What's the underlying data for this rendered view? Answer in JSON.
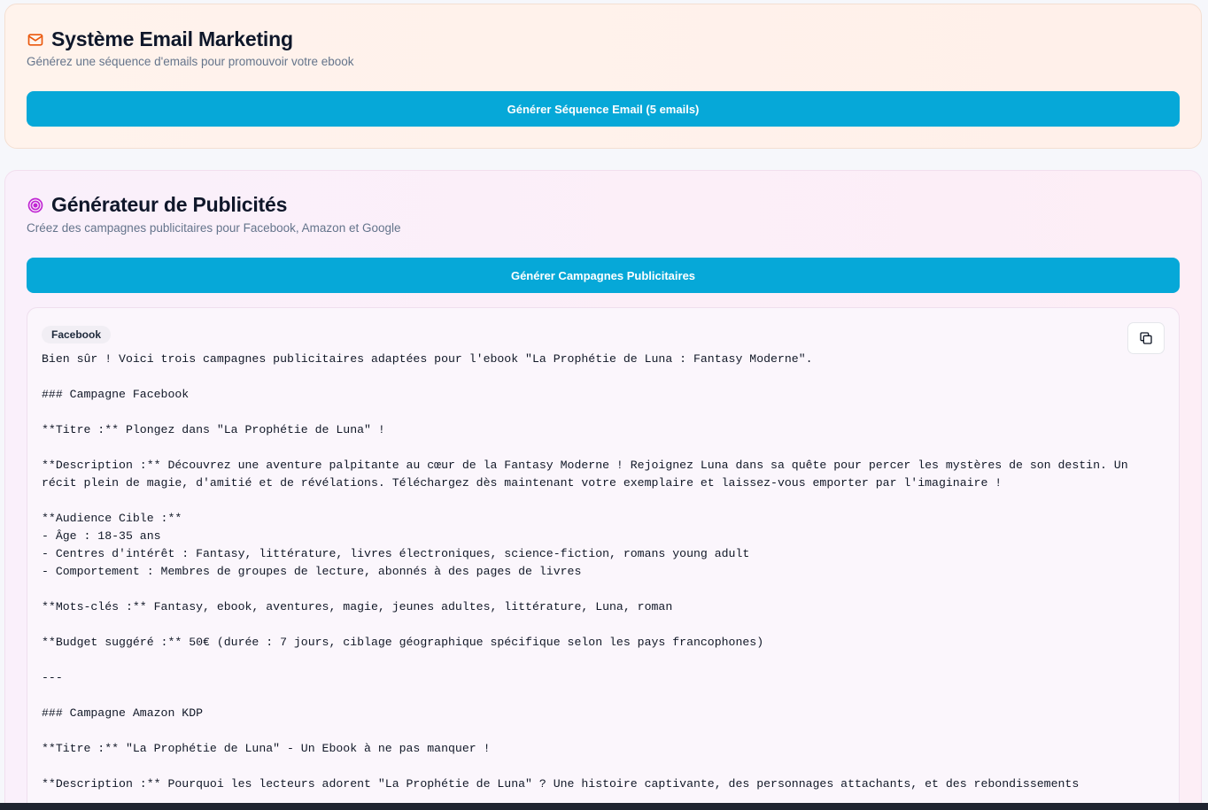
{
  "email_section": {
    "title": "Système Email Marketing",
    "subtitle": "Générez une séquence d'emails pour promouvoir votre ebook",
    "button_label": "Générer Séquence Email (5 emails)",
    "icon": "mail-icon"
  },
  "ads_section": {
    "title": "Générateur de Publicités",
    "subtitle": "Créez des campagnes publicitaires pour Facebook, Amazon et Google",
    "button_label": "Générer Campagnes Publicitaires",
    "icon": "target-icon",
    "result": {
      "badge": "Facebook",
      "copy_icon": "copy-icon",
      "text": "Bien sûr ! Voici trois campagnes publicitaires adaptées pour l'ebook \"La Prophétie de Luna : Fantasy Moderne\".\n\n### Campagne Facebook\n\n**Titre :** Plongez dans \"La Prophétie de Luna\" !\n\n**Description :** Découvrez une aventure palpitante au cœur de la Fantasy Moderne ! Rejoignez Luna dans sa quête pour percer les mystères de son destin. Un récit plein de magie, d'amitié et de révélations. Téléchargez dès maintenant votre exemplaire et laissez-vous emporter par l'imaginaire !\n\n**Audience Cible :**\n- Âge : 18-35 ans\n- Centres d'intérêt : Fantasy, littérature, livres électroniques, science-fiction, romans young adult\n- Comportement : Membres de groupes de lecture, abonnés à des pages de livres\n\n**Mots-clés :** Fantasy, ebook, aventures, magie, jeunes adultes, littérature, Luna, roman\n\n**Budget suggéré :** 50€ (durée : 7 jours, ciblage géographique spécifique selon les pays francophones)\n\n---\n\n### Campagne Amazon KDP\n\n**Titre :** \"La Prophétie de Luna\" - Un Ebook à ne pas manquer !\n\n**Description :** Pourquoi les lecteurs adorent \"La Prophétie de Luna\" ? Une histoire captivante, des personnages attachants, et des rebondissements"
    }
  },
  "colors": {
    "primary_button": "#06a8d8",
    "email_icon": "#ea580c",
    "target_icon": "#c026d3"
  }
}
